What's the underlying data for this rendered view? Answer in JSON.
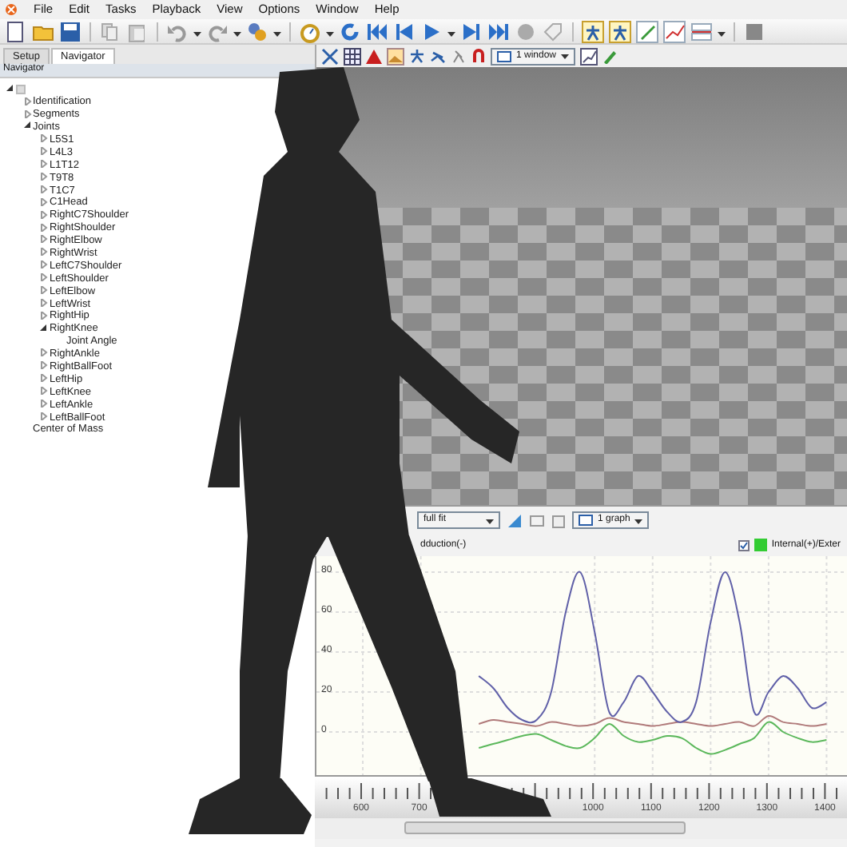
{
  "menu": [
    "File",
    "Edit",
    "Tasks",
    "Playback",
    "View",
    "Options",
    "Window",
    "Help"
  ],
  "tabs": [
    {
      "label": "Setup",
      "selected": false
    },
    {
      "label": "Navigator",
      "selected": true
    }
  ],
  "navigator": {
    "title": "Navigator",
    "tree": [
      {
        "expanded": true,
        "children": [
          {
            "label": "Identification",
            "expanded": false
          },
          {
            "label": "Segments",
            "expanded": false
          },
          {
            "label": "Joints",
            "expanded": true,
            "children": [
              {
                "label": "L5S1",
                "expanded": false
              },
              {
                "label": "L4L3",
                "expanded": false
              },
              {
                "label": "L1T12",
                "expanded": false
              },
              {
                "label": "T9T8",
                "expanded": false
              },
              {
                "label": "T1C7",
                "expanded": false
              },
              {
                "label": "C1Head",
                "expanded": false
              },
              {
                "label": "RightC7Shoulder",
                "expanded": false
              },
              {
                "label": "RightShoulder",
                "expanded": false
              },
              {
                "label": "RightElbow",
                "expanded": false
              },
              {
                "label": "RightWrist",
                "expanded": false
              },
              {
                "label": "LeftC7Shoulder",
                "expanded": false
              },
              {
                "label": "LeftShoulder",
                "expanded": false
              },
              {
                "label": "LeftElbow",
                "expanded": false
              },
              {
                "label": "LeftWrist",
                "expanded": false
              },
              {
                "label": "RightHip",
                "expanded": false
              },
              {
                "label": "RightKnee",
                "expanded": true,
                "children": [
                  {
                    "label": "Joint Angle"
                  }
                ]
              },
              {
                "label": "RightAnkle",
                "expanded": false
              },
              {
                "label": "RightBallFoot",
                "expanded": false
              },
              {
                "label": "LeftHip",
                "expanded": false
              },
              {
                "label": "LeftKnee",
                "expanded": false
              },
              {
                "label": "LeftAnkle",
                "expanded": false
              },
              {
                "label": "LeftBallFoot",
                "expanded": false
              }
            ]
          },
          {
            "label": "Center of Mass"
          }
        ]
      }
    ]
  },
  "view_toolbar": {
    "window_select": "1 window"
  },
  "graph": {
    "fit_select": "full fit",
    "graph_select": "1 graph",
    "legend": [
      {
        "label": "dduction(-)"
      },
      {
        "label": "Internal(+)/Exter",
        "checked": true,
        "color": "#33cc33"
      }
    ],
    "chart_data": {
      "type": "line",
      "x": [
        800,
        825,
        850,
        875,
        900,
        925,
        950,
        975,
        1000,
        1025,
        1050,
        1075,
        1100,
        1125,
        1150,
        1175,
        1200,
        1225,
        1250,
        1275,
        1300,
        1325,
        1350,
        1375,
        1400
      ],
      "series": [
        {
          "color": "#b07a7a",
          "values": [
            4,
            6,
            5,
            4,
            3,
            5,
            4,
            3,
            4,
            7,
            5,
            4,
            3,
            4,
            5,
            4,
            3,
            4,
            5,
            3,
            8,
            5,
            4,
            3,
            4
          ]
        },
        {
          "color": "#5cb85c",
          "values": [
            -8,
            -6,
            -4,
            -2,
            -1,
            -4,
            -7,
            -8,
            -3,
            4,
            -2,
            -5,
            -4,
            -2,
            -3,
            -8,
            -11,
            -9,
            -6,
            -3,
            5,
            0,
            -3,
            -5,
            -4
          ]
        },
        {
          "color": "#6060a8",
          "values": [
            28,
            22,
            12,
            6,
            6,
            20,
            60,
            80,
            50,
            10,
            15,
            28,
            20,
            10,
            5,
            15,
            55,
            80,
            55,
            10,
            20,
            28,
            22,
            12,
            15
          ]
        }
      ],
      "xlim": [
        520,
        1438
      ],
      "ylim": [
        -21.6,
        88
      ],
      "xticks": [
        600,
        700,
        1000,
        1100,
        1200,
        1300,
        1400
      ],
      "yticks": [
        80,
        60,
        40,
        20,
        0
      ],
      "grid": true
    }
  }
}
